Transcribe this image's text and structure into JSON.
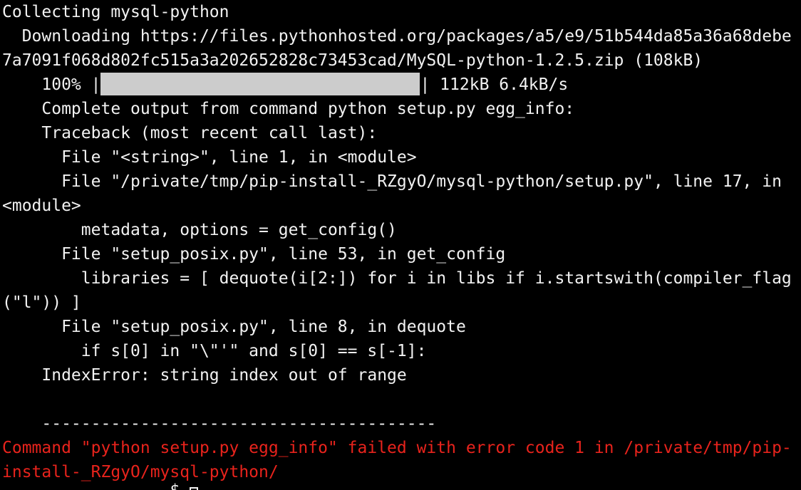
{
  "terminal": {
    "lines": {
      "l1": "Collecting mysql-python",
      "l2": "  Downloading https://files.pythonhosted.org/packages/a5/e9/51b544da85a36a68debe",
      "l3": "7a7091f068d802fc515a3a202652828c73453cad/MySQL-python-1.2.5.zip (108kB)",
      "l4_prefix": "    100% |",
      "l4_suffix": "| 112kB 6.4kB/s",
      "l5": "    Complete output from command python setup.py egg_info:",
      "l6": "    Traceback (most recent call last):",
      "l7": "      File \"<string>\", line 1, in <module>",
      "l8": "      File \"/private/tmp/pip-install-_RZgyO/mysql-python/setup.py\", line 17, in",
      "l9": "<module>",
      "l10": "        metadata, options = get_config()",
      "l11": "      File \"setup_posix.py\", line 53, in get_config",
      "l12": "        libraries = [ dequote(i[2:]) for i in libs if i.startswith(compiler_flag",
      "l13": "(\"l\")) ]",
      "l14": "      File \"setup_posix.py\", line 8, in dequote",
      "l15": "        if s[0] in \"\\\"'\" and s[0] == s[-1]:",
      "l16": "    IndexError: string index out of range",
      "l17": "",
      "l18": "    ----------------------------------------",
      "l19": "Command \"python setup.py egg_info\" failed with error code 1 in /private/tmp/pip-",
      "l20": "install-_RZgyO/mysql-python/",
      "l21": "                 $ "
    },
    "progress_percent": 100,
    "colors": {
      "background": "#000000",
      "text": "#f2f2f2",
      "error": "#e8231c",
      "progress_fill": "#cccccc"
    }
  }
}
